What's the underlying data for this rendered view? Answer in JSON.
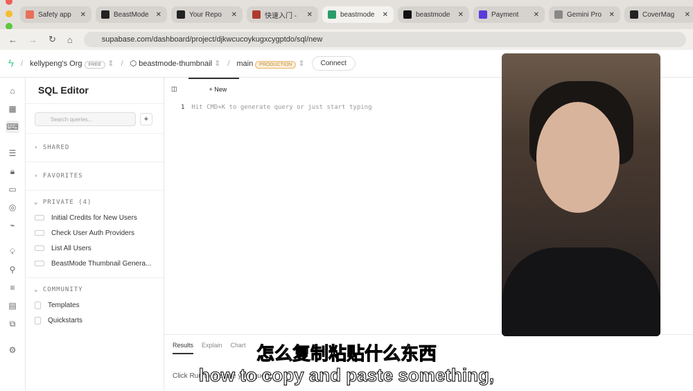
{
  "browser": {
    "tabs": [
      {
        "title": "Safety app",
        "color": "#e8705a"
      },
      {
        "title": "BeastMode",
        "color": "#222"
      },
      {
        "title": "Your Repo",
        "color": "#222"
      },
      {
        "title": "快速入门 -",
        "color": "#b03a2e"
      },
      {
        "title": "beastmode",
        "color": "#2a9d6a",
        "active": true
      },
      {
        "title": "beastmode",
        "color": "#111"
      },
      {
        "title": "Payment",
        "color": "#5a3ad9"
      },
      {
        "title": "Gemini Pro",
        "color": "#888"
      },
      {
        "title": "CoverMag",
        "color": "#222"
      }
    ],
    "url": "supabase.com/dashboard/project/djkwcucoykugxcygptdo/sql/new"
  },
  "topbar": {
    "org": "kellypeng's Org",
    "org_badge": "FREE",
    "project": "beastmode-thumbnail",
    "branch": "main",
    "branch_badge": "PRODUCTION",
    "connect": "Connect"
  },
  "sidebar": {
    "title": "SQL Editor",
    "search_placeholder": "Search queries...",
    "sections": {
      "shared": "SHARED",
      "favorites": "FAVORITES",
      "private": "PRIVATE (4)",
      "community": "COMMUNITY"
    },
    "private_items": [
      "Initial Credits for New Users",
      "Check User Auth Providers",
      "List All Users",
      "BeastMode Thumbnail Genera..."
    ],
    "community_items": [
      "Templates",
      "Quickstarts"
    ]
  },
  "editor": {
    "new_tab": "New",
    "line_number": "1",
    "placeholder": "Hit CMD+K to generate query or just start typing"
  },
  "results": {
    "tabs": [
      "Results",
      "Explain",
      "Chart"
    ],
    "message": "Click Run to execute your query."
  },
  "subtitles": {
    "zh": "怎么复制粘贴什么东西",
    "en": "how to copy and paste something,"
  }
}
